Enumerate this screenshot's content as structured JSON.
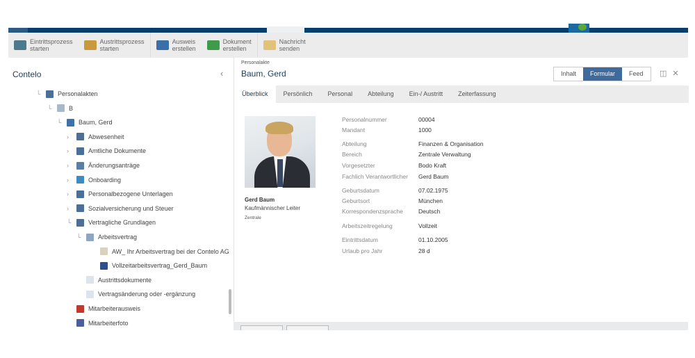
{
  "toolbar": {
    "items": [
      {
        "label1": "Eintrittsprozess",
        "label2": "starten",
        "icon": "person-enter-icon",
        "color": "#4a7a8c"
      },
      {
        "label1": "Austrittsprozess",
        "label2": "starten",
        "icon": "person-exit-icon",
        "color": "#c99a3c"
      },
      {
        "label1": "Ausweis",
        "label2": "erstellen",
        "icon": "id-card-icon",
        "color": "#3b6fa8"
      },
      {
        "label1": "Dokument",
        "label2": "erstellen",
        "icon": "document-add-icon",
        "color": "#3f9a4a"
      },
      {
        "label1": "Nachricht",
        "label2": "senden",
        "icon": "message-icon",
        "color": "#e2c27a"
      }
    ]
  },
  "sidebar": {
    "title": "Contelo",
    "tree": [
      {
        "label": "Personalakten",
        "level": 0,
        "toggle": "expanded",
        "icon": "binder-icon",
        "color": "#4b6f95"
      },
      {
        "label": "B",
        "level": 1,
        "toggle": "expanded",
        "icon": "register-icon",
        "color": "#a9b9c9"
      },
      {
        "label": "Baum, Gerd",
        "level": 2,
        "toggle": "expanded",
        "icon": "personnel-file-icon",
        "color": "#3f72a8"
      },
      {
        "label": "Abwesenheit",
        "level": 3,
        "toggle": "collapsed",
        "icon": "binder-icon",
        "color": "#4b6f95"
      },
      {
        "label": "Amtliche Dokumente",
        "level": 3,
        "toggle": "collapsed",
        "icon": "binder-icon",
        "color": "#4b6f95"
      },
      {
        "label": "Änderungsanträge",
        "level": 3,
        "toggle": "collapsed",
        "icon": "form-icon",
        "color": "#5a7fa6"
      },
      {
        "label": "Onboarding",
        "level": 3,
        "toggle": "collapsed",
        "icon": "onboarding-icon",
        "color": "#3f8ac0"
      },
      {
        "label": "Personalbezogene Unterlagen",
        "level": 3,
        "toggle": "collapsed",
        "icon": "binder-icon",
        "color": "#4b6f95"
      },
      {
        "label": "Sozialversicherung und Steuer",
        "level": 3,
        "toggle": "collapsed",
        "icon": "binder-icon",
        "color": "#4b6f95"
      },
      {
        "label": "Vertragliche Grundlagen",
        "level": 3,
        "toggle": "expanded",
        "icon": "binder-icon",
        "color": "#4b6f95"
      },
      {
        "label": "Arbeitsvertrag",
        "level": 4,
        "toggle": "expanded",
        "icon": "register-icon",
        "color": "#8fa6bf"
      },
      {
        "label": "AW_ Ihr Arbeitsvertrag bei der Contelo AG",
        "level": 5,
        "toggle": "none",
        "icon": "email-icon",
        "color": "#d9d2c0"
      },
      {
        "label": "Vollzeitarbeitsvertrag_Gerd_Baum",
        "level": 5,
        "toggle": "none",
        "icon": "word-document-icon",
        "color": "#2e4f8a"
      },
      {
        "label": "Austrittsdokumente",
        "level": 4,
        "toggle": "none",
        "icon": "register-icon",
        "color": "#dde3ea"
      },
      {
        "label": "Vertragsänderung oder -ergänzung",
        "level": 4,
        "toggle": "none",
        "icon": "register-icon",
        "color": "#dde3ea"
      },
      {
        "label": "Mitarbeiterausweis",
        "level": 3,
        "toggle": "none",
        "icon": "pdf-icon",
        "color": "#c0392b"
      },
      {
        "label": "Mitarbeiterfoto",
        "level": 3,
        "toggle": "none",
        "icon": "image-icon",
        "color": "#4a5fa0"
      }
    ]
  },
  "record": {
    "type": "Personalakte",
    "title": "Baum, Gerd",
    "views": [
      "Inhalt",
      "Formular",
      "Feed"
    ],
    "active_view": "Formular",
    "tabs": [
      "Überblick",
      "Persönlich",
      "Personal",
      "Abteilung",
      "Ein-/ Austritt",
      "Zeiterfassung"
    ],
    "active_tab": "Überblick",
    "profile": {
      "name": "Gerd Baum",
      "role": "Kaufmännischer Leiter",
      "unit": "Zentrale"
    },
    "fields": [
      {
        "label": "Personalnummer",
        "value": "00004"
      },
      {
        "label": "Mandant",
        "value": "1000"
      },
      {
        "label": "Abteilung",
        "value": "Finanzen & Organisation"
      },
      {
        "label": "Bereich",
        "value": "Zentrale Verwaltung"
      },
      {
        "label": "Vorgesetzter",
        "value": "Bodo Kraft"
      },
      {
        "label": "Fachlich Verantwortlicher",
        "value": "Gerd Baum"
      },
      {
        "label": "Geburtsdatum",
        "value": "07.02.1975"
      },
      {
        "label": "Geburtsort",
        "value": "München"
      },
      {
        "label": "Korrespondenzsprache",
        "value": "Deutsch"
      },
      {
        "label": "Arbeitszeitregelung",
        "value": "Vollzeit"
      },
      {
        "label": "Eintrittsdatum",
        "value": "01.10.2005"
      },
      {
        "label": "Urlaub pro Jahr",
        "value": "28  d"
      }
    ]
  },
  "colors": {
    "brand": "#063e6e",
    "accent": "#3e6a9c",
    "title": "#1d3c5c"
  }
}
